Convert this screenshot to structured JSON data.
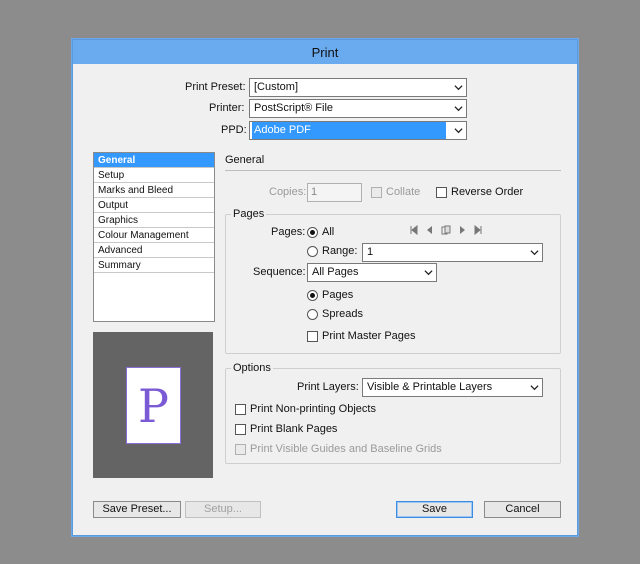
{
  "window": {
    "title": "Print"
  },
  "top": {
    "print_preset_label": "Print Preset:",
    "print_preset_value": "[Custom]",
    "printer_label": "Printer:",
    "printer_value": "PostScript® File",
    "ppd_label": "PPD:",
    "ppd_value": "Adobe PDF"
  },
  "sidebar": {
    "items": [
      {
        "label": "General"
      },
      {
        "label": "Setup"
      },
      {
        "label": "Marks and Bleed"
      },
      {
        "label": "Output"
      },
      {
        "label": "Graphics"
      },
      {
        "label": "Colour Management"
      },
      {
        "label": "Advanced"
      },
      {
        "label": "Summary"
      }
    ]
  },
  "preview": {
    "letter": "P"
  },
  "general": {
    "heading": "General",
    "copies_label": "Copies:",
    "copies_value": "1",
    "collate_label": "Collate",
    "reverse_order_label": "Reverse Order"
  },
  "pages": {
    "group_title": "Pages",
    "pages_label": "Pages:",
    "all_label": "All",
    "range_label": "Range:",
    "range_value": "1",
    "sequence_label": "Sequence:",
    "sequence_value": "All Pages",
    "pages_option": "Pages",
    "spreads_option": "Spreads",
    "print_master_pages": "Print Master Pages"
  },
  "options": {
    "group_title": "Options",
    "print_layers_label": "Print Layers:",
    "print_layers_value": "Visible & Printable Layers",
    "non_printing": "Print Non-printing Objects",
    "blank_pages": "Print Blank Pages",
    "visible_guides": "Print Visible Guides and Baseline Grids"
  },
  "buttons": {
    "save_preset": "Save Preset...",
    "setup": "Setup...",
    "save": "Save",
    "cancel": "Cancel"
  }
}
